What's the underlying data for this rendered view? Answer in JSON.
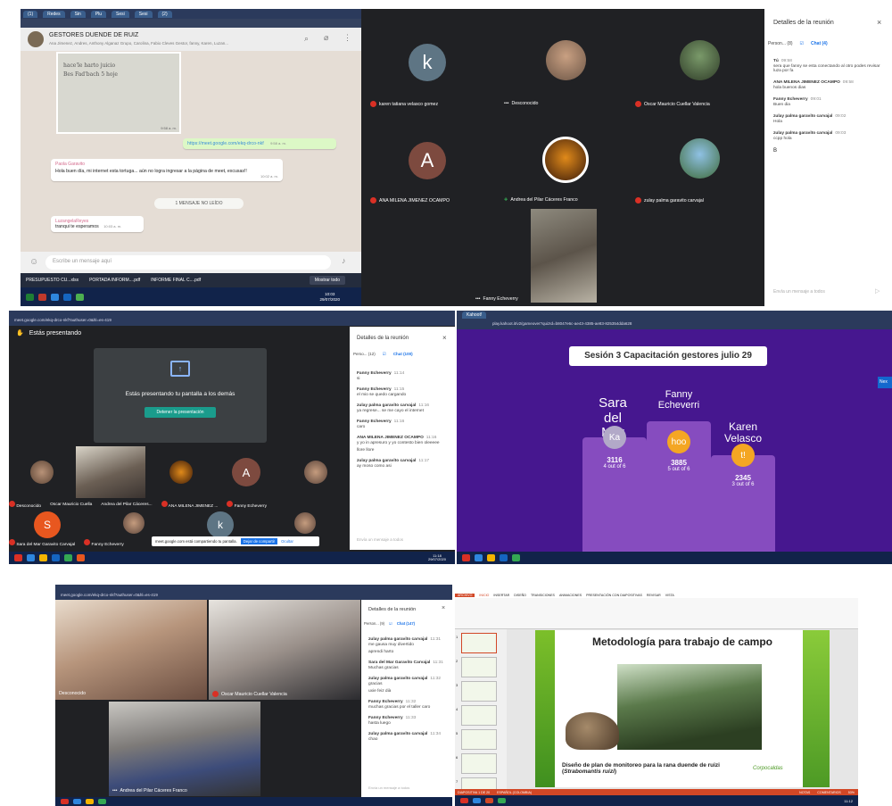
{
  "panel1": {
    "browser_tabs": [
      "(1)",
      "Redes",
      "Sin",
      "Plu",
      "Sesi",
      "Sesi",
      "(2)"
    ],
    "wa": {
      "group_name": "GESTORES DUENDE DE RUIZ",
      "members": "Ana Jimenez, Andres, Anthony Alganaz Grupo, Carolina, Fabio Cleves Gestor, fanny, Karen, Luzan...",
      "note_lines": [
        "hace'le harto juicio",
        "Bes Fad'bach  5 hoje"
      ],
      "note_time": "9:58 a. m.",
      "link": "https://meet.google.com/ekq-drco-nkf",
      "link_time": "9:58 a. m.",
      "msg1_sender": "Paola Garavito",
      "msg1_text": "Hola buen día, mi internet esta tortuga... aún no logra ingresar a la página de meet, excusas!!",
      "msg1_time": "10:02 a. m.",
      "unread": "1 MENSAJE NO LEÍDO",
      "msg2_sender": "LuzangelaReyes",
      "msg2_text": "tranqui te esperamos",
      "msg2_time": "10:03 a. m.",
      "input_placeholder": "Escribe un mensaje aquí"
    },
    "downloads": [
      "PRESUPUESTO CU...xlsx",
      "PORTADA INFORM....pdf",
      "INFORME FINAL C....pdf"
    ],
    "show_all": "Mostrar todo",
    "tray_time": "10:03",
    "tray_date": "29/07/2020",
    "meet_tiles": [
      {
        "letter": "k",
        "name": "karen tatiana velasco gomez"
      },
      {
        "letter": "",
        "name": "Desconocido"
      },
      {
        "letter": "",
        "name": "Oscar Mauricio Cuellar Valencia"
      },
      {
        "letter": "A",
        "name": "ANA MILENA JIMENEZ OCAMPO"
      },
      {
        "letter": "",
        "name": "Andrea del Pilar Cáceres Franco"
      },
      {
        "letter": "",
        "name": "zulay palma garavito carvajal"
      }
    ],
    "bottom_tile": "Fanny Echeverry",
    "details": {
      "title": "Detalles de la reunión",
      "tab_people": "Person... (8)",
      "tab_chat": "Chat (4)",
      "messages": [
        {
          "who": "Tú",
          "time": "09:58",
          "text": "sera que fanny se esta conectando al otro podes revisar luza por fa"
        },
        {
          "who": "ANA MILENA JIMENEZ OCAMPO",
          "time": "09:58",
          "text": "hola buenos dias"
        },
        {
          "who": "Fanny Echeverry",
          "time": "09:01",
          "text": "Buen dia"
        },
        {
          "who": "zulay palma garavito carvajal",
          "time": "09:02",
          "text": "Hola"
        },
        {
          "who": "zulay palma garavito carvajal",
          "time": "09:03",
          "text": "ccpp hola"
        }
      ],
      "extra": "B",
      "input": "Envía un mensaje a todos"
    }
  },
  "panel2": {
    "url": "meet.google.com/ekq-drco-nkf?authuser=0&hl=es-419",
    "presenting": "Estás presentando",
    "share_text": "Estás presentando tu pantalla a los demás",
    "stop_btn": "Detener la presentación",
    "tiles_row1": [
      "Desconocido",
      "Oscar Mauricio Cuella",
      "Andrea del Pilar Cáceres...",
      "ANA MILENA JIMENEZ ...",
      "Fanny Echeverry"
    ],
    "tiles_row2": [
      "Sara del Mar Garavito Carvajal",
      "Fanny Echeverry",
      "",
      ""
    ],
    "tile_S": "S",
    "tile_k": "k",
    "tile_A": "A",
    "share_bar": "meet.google.com está compartiendo tu pantalla.",
    "share_stop": "Dejar de compartir",
    "share_hide": "Ocultar",
    "details": {
      "title": "Detalles de la reunión",
      "tab_people": "Perso... (12)",
      "tab_chat": "Chat (100)",
      "messages": [
        {
          "who": "Fanny Echeverry",
          "time": "11:14",
          "text": "si"
        },
        {
          "who": "Fanny Echeverry",
          "time": "11:15",
          "text": "el mio se quedo cargando"
        },
        {
          "who": "zulay palma garavito carvajal",
          "time": "11:16",
          "text": "ya regrese... se me cayo el internet"
        },
        {
          "who": "Fanny Echeverry",
          "time": "11:16",
          "text": "caro"
        },
        {
          "who": "ANA MILENA JIMENEZ OCAMPO",
          "time": "11:16",
          "text": "y yo in apresuro y yo contesto bien oleeeee"
        },
        {
          "who": "",
          "time": "",
          "text": "llore llore"
        },
        {
          "who": "zulay palma garavito carvajal",
          "time": "11:17",
          "text": "ay moso como asi"
        }
      ],
      "input": "Envía un mensaje a todos"
    },
    "tray_time": "11:18",
    "tray_date": "29/07/2020"
  },
  "panel3": {
    "tab": "Kahoot!",
    "url": "play.kahoot.it/v2/gameover?quizId=b8047e6c-ae43-4385-ae83-825354dda628",
    "title": "Sesión 3 Capacitación gestores julio 29",
    "podium": [
      {
        "name": "Sara del Mar",
        "icon": "Ka",
        "score": "3116",
        "detail": "4 out of 6"
      },
      {
        "name": "Fanny Echeverri",
        "icon": "hoo",
        "score": "3885",
        "detail": "5 out of 6"
      },
      {
        "name": "Karen Velasco",
        "icon": "t!",
        "score": "2345",
        "detail": "3 out of 6"
      }
    ],
    "side_btn": "Nex",
    "colors": {
      "bg": "#46178f",
      "pod": "#864cbf",
      "banner": "#ffffff"
    }
  },
  "panel4": {
    "url": "meet.google.com/ekq-drco-nkf?authuser=0&hl=es-419",
    "tiles": [
      "Desconocido",
      "Oscar Mauricio Cuellar Valencia",
      "Andrea del Pilar Cáceres Franco"
    ],
    "details": {
      "title": "Detalles de la reunión",
      "tab_people": "Person... (9)",
      "tab_chat": "Chat (147)",
      "messages": [
        {
          "who": "zulay palma garavito carvajal",
          "time": "11:31",
          "text": "me gausa muy divertido"
        },
        {
          "who": "",
          "time": "",
          "text": "aprendi harto"
        },
        {
          "who": "Sara del Mar Garavito Carvajal",
          "time": "11:31",
          "text": "Muchas gracias"
        },
        {
          "who": "zulay palma garavito carvajal",
          "time": "11:32",
          "text": "gracias"
        },
        {
          "who": "",
          "time": "",
          "text": "uxie feiz dià"
        },
        {
          "who": "Fanny Echeverry",
          "time": "11:32",
          "text": "muchas gracias por el taller caro"
        },
        {
          "who": "Fanny Echeverry",
          "time": "11:33",
          "text": "hasta luego"
        },
        {
          "who": "zulay palma garavito carvajal",
          "time": "11:34",
          "text": "chao"
        }
      ],
      "input": "Envía un mensaje a todos"
    }
  },
  "panel5": {
    "ribbon_tabs": [
      "ARCHIVO",
      "INICIO",
      "INSERTAR",
      "DISEÑO",
      "TRANSICIONES",
      "ANIMACIONES",
      "PRESENTACIÓN CON DIAPOSITIVAS",
      "REVISAR",
      "VISTA"
    ],
    "slide_title": "Metodología para trabajo de campo",
    "slide_caption": "Diseño de plan de monitoreo para la rana duende de ruizi (",
    "slide_italic": "Strabomantis ruizi",
    "slide_caption_end": ")",
    "logo": "Corpocaldas",
    "status_left": "DIAPOSITIVA 1 DE 20",
    "status_lang": "ESPAÑOL (COLOMBIA)",
    "status_notes": "NOTAS",
    "status_comments": "COMENTARIOS",
    "zoom": "53%",
    "tray_time": "11:12",
    "thumbs": [
      "1",
      "2",
      "3",
      "4",
      "5",
      "6",
      "7"
    ]
  }
}
